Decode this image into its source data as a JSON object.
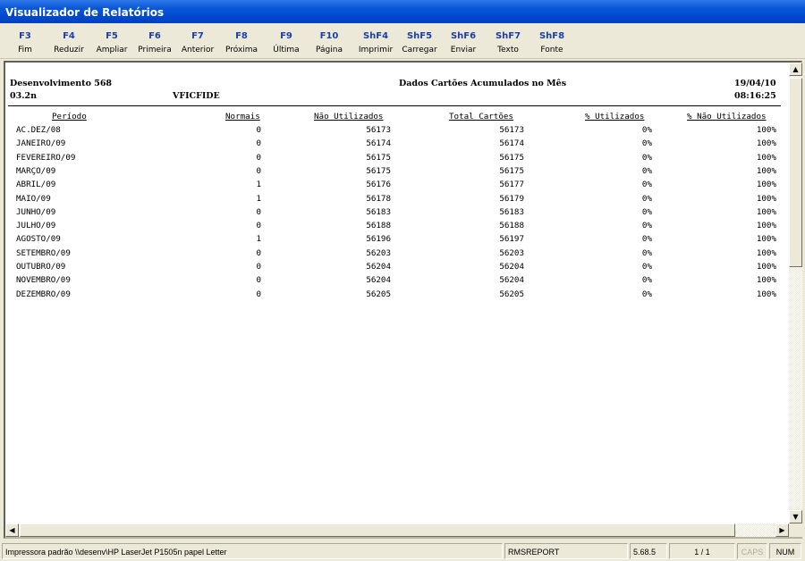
{
  "window": {
    "title": "Visualizador de Relatórios"
  },
  "toolbar": [
    {
      "key": "F3",
      "label": "Fim"
    },
    {
      "key": "F4",
      "label": "Reduzir"
    },
    {
      "key": "F5",
      "label": "Ampliar"
    },
    {
      "key": "F6",
      "label": "Primeira"
    },
    {
      "key": "F7",
      "label": "Anterior"
    },
    {
      "key": "F8",
      "label": "Próxima"
    },
    {
      "key": "F9",
      "label": "Última"
    },
    {
      "key": "F10",
      "label": "Página"
    },
    {
      "key": "ShF4",
      "label": "Imprimir"
    },
    {
      "key": "ShF5",
      "label": "Carregar"
    },
    {
      "key": "ShF6",
      "label": "Enviar"
    },
    {
      "key": "ShF7",
      "label": "Texto"
    },
    {
      "key": "ShF8",
      "label": "Fonte"
    }
  ],
  "report": {
    "system": "Desenvolvimento 568",
    "title": "Dados Cartões Acumulados no Mês",
    "date": "19/04/10",
    "code": "03.2n",
    "program": "VFICFIDE",
    "time": "08:16:25",
    "columns": [
      "Período",
      "Normais",
      "Não Utilizados",
      "Total Cartões",
      "% Utilizados",
      "% Não Utilizados"
    ],
    "rows": [
      [
        "AC.DEZ/08",
        "0",
        "56173",
        "56173",
        "0%",
        "100%"
      ],
      [
        "JANEIRO/09",
        "0",
        "56174",
        "56174",
        "0%",
        "100%"
      ],
      [
        "FEVEREIRO/09",
        "0",
        "56175",
        "56175",
        "0%",
        "100%"
      ],
      [
        "MARÇO/09",
        "0",
        "56175",
        "56175",
        "0%",
        "100%"
      ],
      [
        "ABRIL/09",
        "1",
        "56176",
        "56177",
        "0%",
        "100%"
      ],
      [
        "MAIO/09",
        "1",
        "56178",
        "56179",
        "0%",
        "100%"
      ],
      [
        "JUNHO/09",
        "0",
        "56183",
        "56183",
        "0%",
        "100%"
      ],
      [
        "JULHO/09",
        "0",
        "56188",
        "56188",
        "0%",
        "100%"
      ],
      [
        "AGOSTO/09",
        "1",
        "56196",
        "56197",
        "0%",
        "100%"
      ],
      [
        "SETEMBRO/09",
        "0",
        "56203",
        "56203",
        "0%",
        "100%"
      ],
      [
        "OUTUBRO/09",
        "0",
        "56204",
        "56204",
        "0%",
        "100%"
      ],
      [
        "NOVEMBRO/09",
        "0",
        "56204",
        "56204",
        "0%",
        "100%"
      ],
      [
        "DEZEMBRO/09",
        "0",
        "56205",
        "56205",
        "0%",
        "100%"
      ]
    ]
  },
  "statusbar": {
    "printer": "Impressora padrão \\\\desenv\\HP LaserJet P1505n papel Letter",
    "report_name": "RMSREPORT",
    "version": "5.68.5",
    "page": "1 / 1",
    "caps": "CAPS",
    "num": "NUM"
  },
  "colors": {
    "titlebar": "#0a58d8",
    "key_text": "#1c3fa8",
    "face": "#ece9d8"
  }
}
